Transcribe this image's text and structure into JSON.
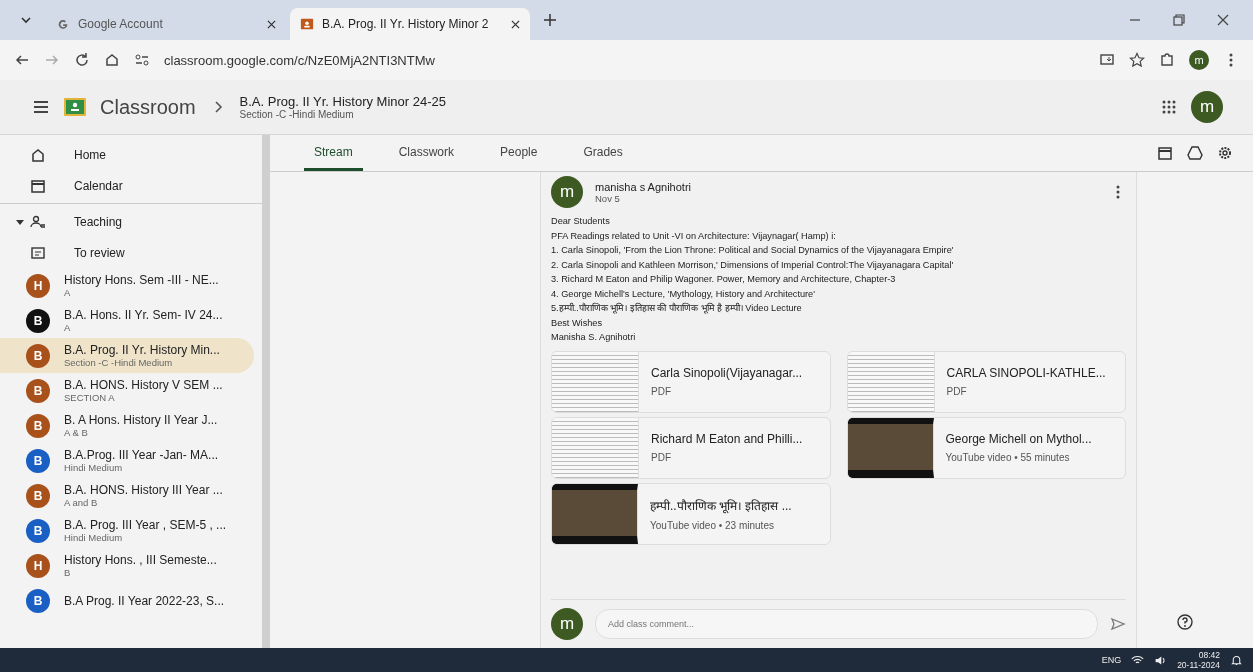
{
  "browser": {
    "tabs": [
      {
        "title": "Google Account",
        "selected": false
      },
      {
        "title": "B.A. Prog. II Yr. History Minor 2",
        "selected": true
      }
    ],
    "url": "classroom.google.com/c/NzE0MjA2NTI3NTMw",
    "profile_initial": "m"
  },
  "header": {
    "app_name": "Classroom",
    "course_title": "B.A. Prog. II Yr. History Minor 24-25",
    "course_section": "Section -C -Hindi Medium",
    "profile_initial": "m"
  },
  "sidebar": {
    "nav": [
      {
        "label": "Home"
      },
      {
        "label": "Calendar"
      }
    ],
    "teaching": {
      "label": "Teaching",
      "expanded": true
    },
    "to_review": "To review",
    "classes": [
      {
        "initial": "H",
        "color": "#a8511b",
        "title": "History Hons. Sem -III - NE...",
        "subtitle": "A",
        "selected": false
      },
      {
        "initial": "B",
        "color": "#111111",
        "title": "B.A. Hons. II Yr. Sem- IV 24...",
        "subtitle": "A",
        "selected": false
      },
      {
        "initial": "B",
        "color": "#a8511b",
        "title": "B.A. Prog. II Yr. History Min...",
        "subtitle": "Section -C -Hindi Medium",
        "selected": true
      },
      {
        "initial": "B",
        "color": "#a8511b",
        "title": "B.A. HONS. History V SEM ...",
        "subtitle": "SECTION A",
        "selected": false
      },
      {
        "initial": "B",
        "color": "#a8511b",
        "title": "B. A Hons. History II Year J...",
        "subtitle": "A & B",
        "selected": false
      },
      {
        "initial": "B",
        "color": "#1a5fc4",
        "title": "B.A.Prog. III Year -Jan- MA...",
        "subtitle": "Hindi Medium",
        "selected": false
      },
      {
        "initial": "B",
        "color": "#a8511b",
        "title": "B.A. HONS. History III Year ...",
        "subtitle": "A and B",
        "selected": false
      },
      {
        "initial": "B",
        "color": "#1a5fc4",
        "title": "B.A. Prog. III Year , SEM-5 , ...",
        "subtitle": "Hindi Medium",
        "selected": false
      },
      {
        "initial": "H",
        "color": "#a8511b",
        "title": "History Hons. , III Semeste...",
        "subtitle": "B",
        "selected": false
      },
      {
        "initial": "B",
        "color": "#1a5fc4",
        "title": "B.A Prog. II Year 2022-23, S...",
        "selected": false
      }
    ]
  },
  "course_tabs": [
    {
      "label": "Stream",
      "selected": true
    },
    {
      "label": "Classwork",
      "selected": false
    },
    {
      "label": "People",
      "selected": false
    },
    {
      "label": "Grades",
      "selected": false
    }
  ],
  "post": {
    "author": "manisha s Agnihotri",
    "author_initial": "m",
    "date": "Nov 5",
    "lines": [
      "Dear Students",
      "PFA Readings related to Unit -VI  on Architecture: Vijaynagar( Hamp) i:",
      "1. Carla Sinopoli, 'From the Lion Throne: Political and Social Dynamics of the Vijayanagara Empire'",
      "2. Carla Sinopoli and Kathleen Morrison,' Dimensions of Imperial Control:The Vijayanagara Capital'",
      "3. Richard M Eaton and Philip Wagoner. Power, Memory and Architecture, Chapter-3",
      "4. George Michell's Lecture, 'Mythology, History and Architecture'",
      "5.हम्पी..पौराणिक भूमि। इतिहास की पौराणिक भूमि है हम्पी। Video Lecture",
      "Best Wishes",
      "Manisha S. Agnihotri"
    ],
    "attachments": [
      {
        "kind": "pdf",
        "title": "Carla Sinopoli(Vijayanagar...",
        "meta": "PDF"
      },
      {
        "kind": "pdf",
        "title": "CARLA SINOPOLI-KATHLE...",
        "meta": "PDF"
      },
      {
        "kind": "pdf",
        "title": "Richard M Eaton and Philli...",
        "meta": "PDF"
      },
      {
        "kind": "video",
        "title": "George Michell on Mythol...",
        "meta": "YouTube video • 55 minutes"
      },
      {
        "kind": "video",
        "title": "हम्पी..पौराणिक भूमि। इतिहास ...",
        "meta": "YouTube video • 23 minutes"
      }
    ],
    "comment_placeholder": "Add class comment...",
    "commenter_initial": "m"
  },
  "taskbar": {
    "language": "ENG",
    "time": "08:42",
    "date": "20-11-2024"
  }
}
